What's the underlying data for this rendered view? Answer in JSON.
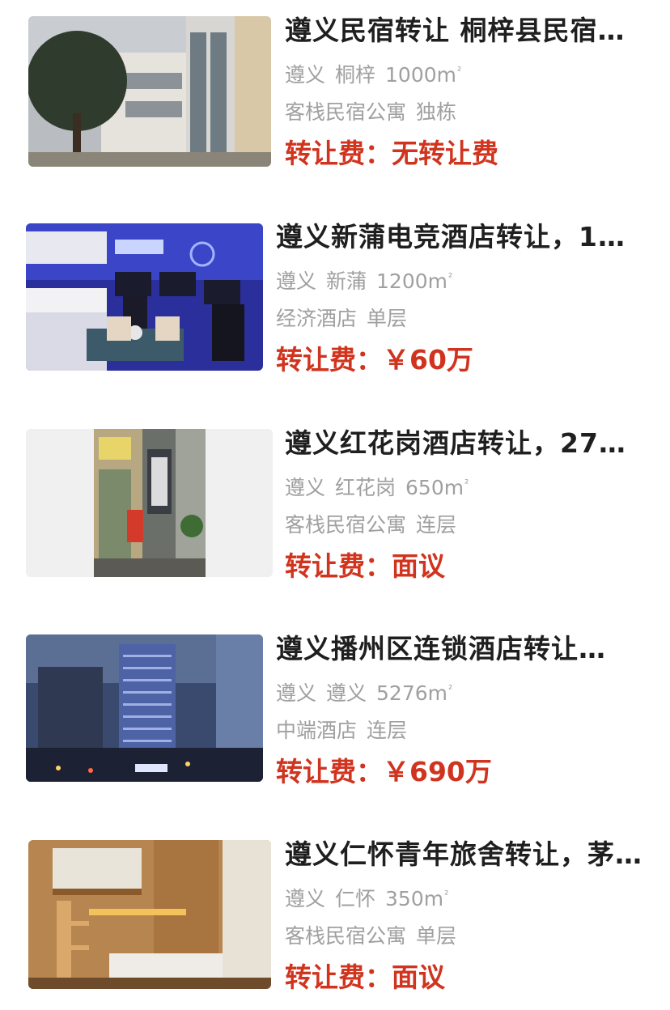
{
  "listings": [
    {
      "title": "遵义民宿转让 桐梓县民宿…",
      "city": "遵义",
      "district": "桐梓",
      "area": "1000m",
      "area_unit": "²",
      "type": "客栈民宿公寓",
      "floor": "独栋",
      "fee_label": "转让费：",
      "fee_value": "无转让费"
    },
    {
      "title": "遵义新蒲电竞酒店转让，1…",
      "city": "遵义",
      "district": "新蒲",
      "area": "1200m",
      "area_unit": "²",
      "type": "经济酒店",
      "floor": "单层",
      "fee_label": "转让费：",
      "fee_value": "￥60万"
    },
    {
      "title": "遵义红花岗酒店转让，27…",
      "city": "遵义",
      "district": "红花岗",
      "area": "650m",
      "area_unit": "²",
      "type": "客栈民宿公寓",
      "floor": "连层",
      "fee_label": "转让费：",
      "fee_value": "面议"
    },
    {
      "title": "遵义播州区连锁酒店转让…",
      "city": "遵义",
      "district": "遵义",
      "area": "5276m",
      "area_unit": "²",
      "type": "中端酒店",
      "floor": "连层",
      "fee_label": "转让费：",
      "fee_value": "￥690万"
    },
    {
      "title": "遵义仁怀青年旅舍转让，茅…",
      "city": "遵义",
      "district": "仁怀",
      "area": "350m",
      "area_unit": "²",
      "type": "客栈民宿公寓",
      "floor": "单层",
      "fee_label": "转让费：",
      "fee_value": "面议"
    }
  ],
  "images": [
    {
      "icon": "building-photo"
    },
    {
      "icon": "esports-hotel-room-photo"
    },
    {
      "icon": "hotel-entrance-photo"
    },
    {
      "icon": "city-night-skyline-photo"
    },
    {
      "icon": "hostel-bunk-photo"
    }
  ],
  "colors": {
    "title": "#1f1f1f",
    "meta": "#a0a0a0",
    "fee": "#d0341f"
  }
}
